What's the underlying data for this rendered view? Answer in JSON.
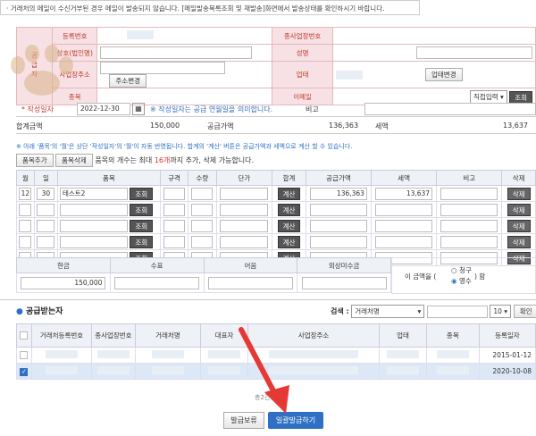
{
  "notice": "· 거래처의 메일이 수신거부된 경우 메일이 발송되지 않습니다. [메일발송목록조회 및 재발송]화면에서 발송상태를 확인하시기 바랍니다.",
  "supplier": {
    "side_label": "공급자",
    "reg_no_label": "등록번호",
    "branch_no_label": "종사업장번호",
    "company_label": "상호(법인명)",
    "name_label": "성명",
    "address_label": "사업장주소",
    "address_btn": "주소변경",
    "biz_type_label": "업태",
    "biz_change_btn": "업태변경",
    "item_label": "종목",
    "email_label": "이메일",
    "email_select": "직접입력",
    "lookup_btn": "조회"
  },
  "dates": {
    "write_date_label": "* 작성일자",
    "write_date_value": "2022-12-30",
    "write_date_note": "※ 작성일자는 공급 연월일을 의미합니다.",
    "remark_label": "비고"
  },
  "totals": {
    "total_label": "합계금액",
    "total_value": "150,000",
    "supply_label": "공급가액",
    "supply_value": "136,363",
    "tax_label": "세액",
    "tax_value": "13,637"
  },
  "item_note": "※ 아래 '품목'의 '월'은 상단 '작성일자'의 '월'이 자동 반영됩니다. 합계의 '계산' 버튼은 공급가액과 세액으로 계산 할 수 있습니다.",
  "item_controls": {
    "add_btn": "품목추가",
    "delete_btn": "품목삭제",
    "limit_prefix": "품목의 개수는 최대 ",
    "limit_count": "16개",
    "limit_suffix": "까지 추가, 삭제 가능합니다."
  },
  "item_table": {
    "headers": [
      "월",
      "일",
      "품목",
      "규격",
      "수량",
      "단가",
      "합계",
      "공급가액",
      "세액",
      "비고",
      "삭제"
    ],
    "lookup_btn": "조회",
    "calc_btn": "계산",
    "delete_btn": "삭제",
    "rows": [
      {
        "month": "12",
        "day": "30",
        "item": "테스트2",
        "supply": "136,363",
        "tax": "13,637"
      },
      {
        "month": "",
        "day": "",
        "item": "",
        "supply": "",
        "tax": ""
      },
      {
        "month": "",
        "day": "",
        "item": "",
        "supply": "",
        "tax": ""
      },
      {
        "month": "",
        "day": "",
        "item": "",
        "supply": "",
        "tax": ""
      },
      {
        "month": "",
        "day": "",
        "item": "",
        "supply": "",
        "tax": ""
      }
    ]
  },
  "payment": {
    "headers": [
      "현금",
      "수표",
      "어음",
      "외상미수금"
    ],
    "cash_value": "150,000",
    "amount_prefix": "이 금액을 (",
    "amount_suffix": ") 함",
    "opt_claim": "청구",
    "opt_receipt": "영수"
  },
  "receivers": {
    "title": "공급받는자",
    "search_label": "검색 :",
    "search_select": "거래처명",
    "page_size": "10",
    "confirm_btn": "확인",
    "headers": [
      "",
      "거래처등록번호",
      "종사업장번호",
      "거래처명",
      "대표자",
      "사업장주소",
      "업태",
      "종목",
      "등록일자"
    ],
    "rows": [
      {
        "checked": false,
        "date": "2015-01-12"
      },
      {
        "checked": true,
        "date": "2020-10-08"
      }
    ],
    "total": "총2건(1/1)"
  },
  "actions": {
    "hold_btn": "발급보류",
    "issue_btn": "일괄발급하기"
  },
  "colors": {
    "accent_red": "#e53935",
    "primary_blue": "#2f6fc4",
    "label_pink": "#f7e1e4"
  }
}
